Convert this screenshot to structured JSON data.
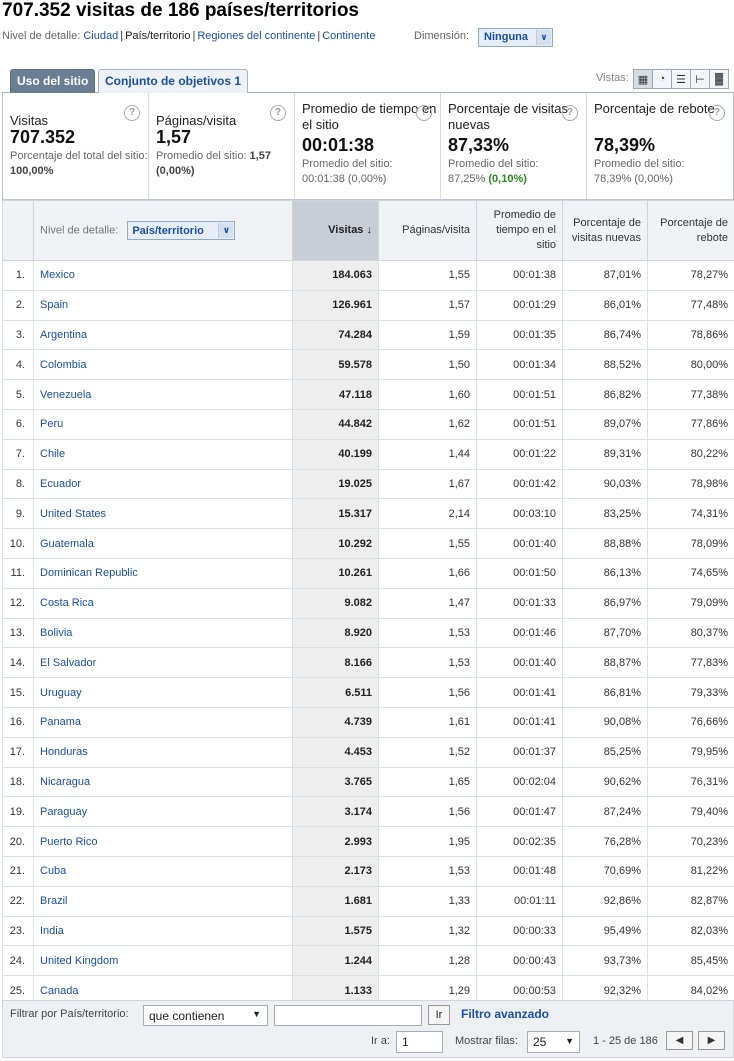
{
  "page": {
    "title": "707.352 visitas de 186 países/territorios"
  },
  "detail_bar": {
    "label": "Nivel de detalle:",
    "links": [
      "Ciudad",
      "País/territorio",
      "Regiones del continente",
      "Continente"
    ],
    "current": "País/territorio",
    "dimension_label": "Dimensión:",
    "dimension_value": "Ninguna"
  },
  "tabs": {
    "active": "Uso del sitio",
    "inactive": "Conjunto de objetivos 1",
    "views_label": "Vistas:"
  },
  "summary": [
    {
      "name": "Visitas",
      "value": "707.352",
      "sub1": "Porcentaje del total del sitio: ",
      "sub1_bold": "100,00%",
      "sub2": "",
      "sub2_extra": ""
    },
    {
      "name": "Páginas/visita",
      "value": "1,57",
      "sub1": "Promedio del sitio: ",
      "sub1_bold": "1,57",
      "sub2": "(0,00%)",
      "sub2_extra": ""
    },
    {
      "name": "Promedio de tiempo en el sitio",
      "value": "00:01:38",
      "sub1": "Promedio del sitio:",
      "sub1_bold": "",
      "sub2": "00:01:38 (0,00%)",
      "sub2_extra": ""
    },
    {
      "name": "Porcentaje de visitas nuevas",
      "value": "87,33%",
      "sub1": "Promedio del sitio:",
      "sub1_bold": "",
      "sub2": "87,25% ",
      "sub2_extra": "(0,10%)"
    },
    {
      "name": "Porcentaje de rebote",
      "value": "78,39%",
      "sub1": "Promedio del sitio:",
      "sub1_bold": "",
      "sub2": "78,39% (0,00%)",
      "sub2_extra": ""
    }
  ],
  "table": {
    "detail_label": "Nivel de detalle:",
    "detail_value": "País/territorio",
    "headers": [
      "Visitas",
      "Páginas/visita",
      "Promedio de tiempo en el sitio",
      "Porcentaje de visitas nuevas",
      "Porcentaje de rebote"
    ],
    "sort_arrow": "↓",
    "rows": [
      [
        "1.",
        "Mexico",
        "184.063",
        "1,55",
        "00:01:38",
        "87,01%",
        "78,27%"
      ],
      [
        "2.",
        "Spain",
        "126.961",
        "1,57",
        "00:01:29",
        "86,01%",
        "77,48%"
      ],
      [
        "3.",
        "Argentina",
        "74.284",
        "1,59",
        "00:01:35",
        "86,74%",
        "78,86%"
      ],
      [
        "4.",
        "Colombia",
        "59.578",
        "1,50",
        "00:01:34",
        "88,52%",
        "80,00%"
      ],
      [
        "5.",
        "Venezuela",
        "47.118",
        "1,60",
        "00:01:51",
        "86,82%",
        "77,38%"
      ],
      [
        "6.",
        "Peru",
        "44.842",
        "1,62",
        "00:01:51",
        "89,07%",
        "77,86%"
      ],
      [
        "7.",
        "Chile",
        "40.199",
        "1,44",
        "00:01:22",
        "89,31%",
        "80,22%"
      ],
      [
        "8.",
        "Ecuador",
        "19.025",
        "1,67",
        "00:01:42",
        "90,03%",
        "78,98%"
      ],
      [
        "9.",
        "United States",
        "15.317",
        "2,14",
        "00:03:10",
        "83,25%",
        "74,31%"
      ],
      [
        "10.",
        "Guatemala",
        "10.292",
        "1,55",
        "00:01:40",
        "88,88%",
        "78,09%"
      ],
      [
        "11.",
        "Dominican Republic",
        "10.261",
        "1,66",
        "00:01:50",
        "86,13%",
        "74,65%"
      ],
      [
        "12.",
        "Costa Rica",
        "9.082",
        "1,47",
        "00:01:33",
        "86,97%",
        "79,09%"
      ],
      [
        "13.",
        "Bolivia",
        "8.920",
        "1,53",
        "00:01:46",
        "87,70%",
        "80,37%"
      ],
      [
        "14.",
        "El Salvador",
        "8.166",
        "1,53",
        "00:01:40",
        "88,87%",
        "77,83%"
      ],
      [
        "15.",
        "Uruguay",
        "6.511",
        "1,56",
        "00:01:41",
        "86,81%",
        "79,33%"
      ],
      [
        "16.",
        "Panama",
        "4.739",
        "1,61",
        "00:01:41",
        "90,08%",
        "76,66%"
      ],
      [
        "17.",
        "Honduras",
        "4.453",
        "1,52",
        "00:01:37",
        "85,25%",
        "79,95%"
      ],
      [
        "18.",
        "Nicaragua",
        "3.765",
        "1,65",
        "00:02:04",
        "90,62%",
        "76,31%"
      ],
      [
        "19.",
        "Paraguay",
        "3.174",
        "1,56",
        "00:01:47",
        "87,24%",
        "79,40%"
      ],
      [
        "20.",
        "Puerto Rico",
        "2.993",
        "1,95",
        "00:02:35",
        "76,28%",
        "70,23%"
      ],
      [
        "21.",
        "Cuba",
        "2.173",
        "1,53",
        "00:01:48",
        "70,69%",
        "81,22%"
      ],
      [
        "22.",
        "Brazil",
        "1.681",
        "1,33",
        "00:01:11",
        "92,86%",
        "82,87%"
      ],
      [
        "23.",
        "India",
        "1.575",
        "1,32",
        "00:00:33",
        "95,49%",
        "82,03%"
      ],
      [
        "24.",
        "United Kingdom",
        "1.244",
        "1,28",
        "00:00:43",
        "93,73%",
        "85,45%"
      ],
      [
        "25.",
        "Canada",
        "1.133",
        "1,29",
        "00:00:53",
        "92,32%",
        "84,02%"
      ]
    ]
  },
  "footer": {
    "filter_label": "Filtrar por País/territorio:",
    "filter_mode": "que contienen",
    "filter_value": "",
    "go_label": "Ir",
    "advanced": "Filtro avanzado",
    "goto_label": "Ir a:",
    "goto_value": "1",
    "rows_label": "Mostrar filas:",
    "rows_value": "25",
    "range": "1 - 25 de 186"
  }
}
